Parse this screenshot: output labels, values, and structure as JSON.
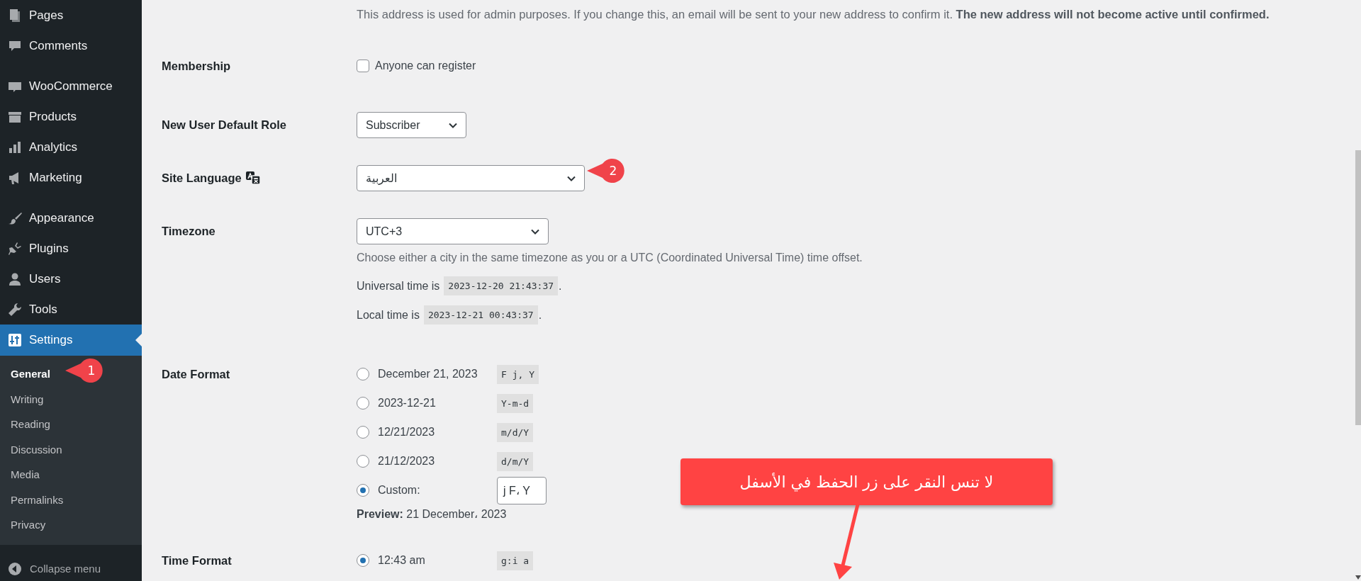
{
  "sidebar": {
    "menu_groups": [
      {
        "items": [
          {
            "label": "Pages",
            "selected": false
          },
          {
            "label": "Comments",
            "selected": false
          }
        ]
      },
      {
        "items": [
          {
            "label": "WooCommerce",
            "selected": false
          },
          {
            "label": "Products",
            "selected": false
          },
          {
            "label": "Analytics",
            "selected": false
          },
          {
            "label": "Marketing",
            "selected": false
          }
        ]
      },
      {
        "items": [
          {
            "label": "Appearance",
            "selected": false
          },
          {
            "label": "Plugins",
            "selected": false
          },
          {
            "label": "Users",
            "selected": false
          },
          {
            "label": "Tools",
            "selected": false
          },
          {
            "label": "Settings",
            "selected": true
          }
        ]
      }
    ],
    "submenu": [
      {
        "label": "General",
        "selected": true
      },
      {
        "label": "Writing",
        "selected": false
      },
      {
        "label": "Reading",
        "selected": false
      },
      {
        "label": "Discussion",
        "selected": false
      },
      {
        "label": "Media",
        "selected": false
      },
      {
        "label": "Permalinks",
        "selected": false
      },
      {
        "label": "Privacy",
        "selected": false
      }
    ],
    "collapse": "Collapse menu"
  },
  "settings": {
    "email_note": "This address is used for admin purposes. If you change this, an email will be sent to your new address to confirm it. **The new address will not become active until confirmed.**",
    "membership": {
      "label": "Membership",
      "option": "Anyone can register",
      "checked": false
    },
    "default_role": {
      "label": "New User Default Role",
      "value": "Subscriber"
    },
    "site_language": {
      "label": "Site Language",
      "value": "العربية"
    },
    "timezone": {
      "label": "Timezone",
      "value": "UTC+3",
      "description": "Choose either a city in the same timezone as you or a UTC (Coordinated Universal Time) time offset.",
      "times": [
        {
          "prefix": "Universal time is",
          "value": "2023-12-20 21:43:37",
          "suffix": "."
        },
        {
          "prefix": "Local time is",
          "value": "2023-12-21 00:43:37",
          "suffix": "."
        }
      ]
    },
    "date_format": {
      "label": "Date Format",
      "options": [
        {
          "kind": "preset",
          "label": "December 21, 2023",
          "code": "F j, Y",
          "selected": false
        },
        {
          "kind": "preset",
          "label": "2023-12-21",
          "code": "Y-m-d",
          "selected": false
        },
        {
          "kind": "preset",
          "label": "12/21/2023",
          "code": "m/d/Y",
          "selected": false
        },
        {
          "kind": "preset",
          "label": "21/12/2023",
          "code": "d/m/Y",
          "selected": false
        },
        {
          "kind": "custom",
          "label": "Custom:",
          "value": "j F، Y",
          "selected": true
        }
      ],
      "preview": "**Preview:** 21 December، 2023"
    },
    "time_format": {
      "label": "Time Format",
      "options": [
        {
          "kind": "preset",
          "label": "12:43 am",
          "code": "g:i a",
          "selected": true
        }
      ]
    }
  },
  "annotations": [
    {
      "kind": "badge",
      "text": "1"
    },
    {
      "kind": "badge",
      "text": "2"
    },
    {
      "kind": "callout",
      "text": "لا تنس النقر على زر الحفظ في الأسفل"
    }
  ]
}
